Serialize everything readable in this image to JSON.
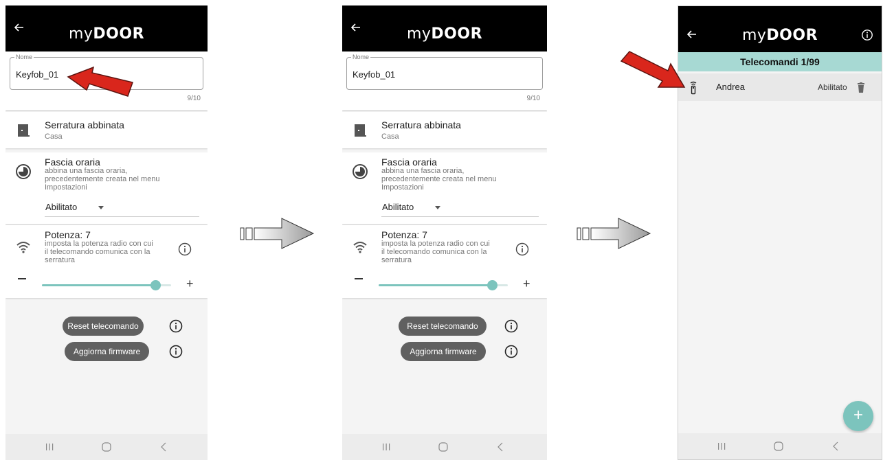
{
  "brand": {
    "logo_my": "my",
    "logo_door": "DOOR",
    "accent": "#7cc4bd",
    "header_bg": "#000000",
    "button_bg": "#606060",
    "arrow_red": "#d9261c"
  },
  "screen1": {
    "name_field": {
      "label": "Nome",
      "value": "Keyfob_01",
      "counter": "9/10"
    },
    "lock": {
      "title": "Serratura abbinata",
      "value": "Casa"
    },
    "schedule": {
      "title": "Fascia oraria",
      "desc_line1": "abbina una fascia oraria,",
      "desc_line2": "precedentemente creata nel menu",
      "desc_line3": "Impostazioni",
      "selected": "Abilitato"
    },
    "power": {
      "title": "Potenza: 7",
      "desc_line1": "imposta la potenza radio con cui",
      "desc_line2": "il telecomando comunica con la",
      "desc_line3": "serratura",
      "minus": "−",
      "plus": "+",
      "level": 7,
      "max": 8
    },
    "reset_button": "Reset telecomando",
    "firmware_button": "Aggiorna firmware"
  },
  "screen2": {
    "name_field": {
      "label": "Nome",
      "value": "Keyfob_01",
      "counter": "9/10"
    },
    "lock": {
      "title": "Serratura abbinata",
      "value": "Casa"
    },
    "schedule": {
      "title": "Fascia oraria",
      "desc_line1": "abbina una fascia oraria,",
      "desc_line2": "precedentemente creata nel menu",
      "desc_line3": "Impostazioni",
      "selected": "Abilitato"
    },
    "power": {
      "title": "Potenza: 7",
      "desc_line1": "imposta la potenza radio con cui",
      "desc_line2": "il telecomando comunica con la",
      "desc_line3": "serratura",
      "minus": "−",
      "plus": "+",
      "level": 7,
      "max": 8
    },
    "reset_button": "Reset telecomando",
    "firmware_button": "Aggiorna firmware"
  },
  "screen3": {
    "header": "Telecomandi 1/99",
    "items": [
      {
        "name": "Andrea",
        "status": "Abilitato"
      }
    ],
    "fab": "+"
  },
  "icons": [
    "back-arrow-icon",
    "door-icon",
    "clock-icon",
    "wifi-icon",
    "info-icon",
    "remote-icon",
    "trash-icon",
    "recent-apps-icon",
    "home-icon",
    "back-nav-icon"
  ]
}
